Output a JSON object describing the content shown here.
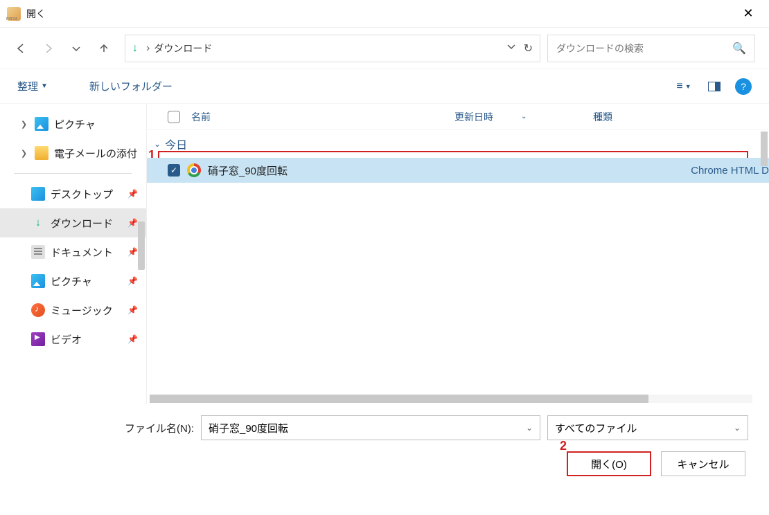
{
  "window": {
    "title": "開く"
  },
  "nav": {
    "path": "ダウンロード",
    "search_placeholder": "ダウンロードの検索"
  },
  "toolbar": {
    "organize": "整理",
    "newfolder": "新しいフォルダー"
  },
  "sidebar": {
    "tree": [
      {
        "label": "ピクチャ"
      },
      {
        "label": "電子メールの添付"
      }
    ],
    "quick": [
      {
        "label": "デスクトップ"
      },
      {
        "label": "ダウンロード"
      },
      {
        "label": "ドキュメント"
      },
      {
        "label": "ピクチャ"
      },
      {
        "label": "ミュージック"
      },
      {
        "label": "ビデオ"
      }
    ]
  },
  "columns": {
    "name": "名前",
    "date": "更新日時",
    "type": "種類"
  },
  "group": {
    "today": "今日"
  },
  "files": [
    {
      "name": "硝子窓_90度回転",
      "type": "Chrome HTML D"
    }
  ],
  "footer": {
    "filename_label": "ファイル名(N):",
    "filename_value": "硝子窓_90度回転",
    "filter": "すべてのファイル",
    "open": "開く(O)",
    "cancel": "キャンセル"
  },
  "annotations": {
    "one": "1",
    "two": "2"
  }
}
